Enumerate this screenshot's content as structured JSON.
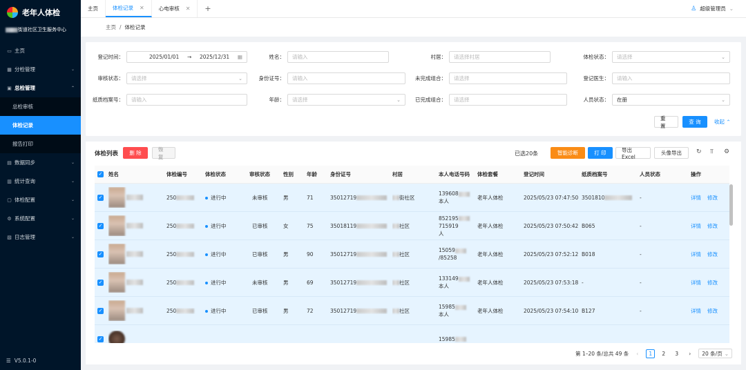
{
  "app": {
    "title": "老年人体检",
    "org_suffix": "街道社区卫生服务中心",
    "version": "V5.0.1-0"
  },
  "sidebar": {
    "items": [
      {
        "label": "主页",
        "icon": "home-icon"
      },
      {
        "label": "分检管理",
        "icon": "grid-icon"
      },
      {
        "label": "总检管理",
        "icon": "file-icon"
      },
      {
        "label": "数据同步",
        "icon": "sync-icon"
      },
      {
        "label": "统计查询",
        "icon": "chart-icon"
      },
      {
        "label": "体检配置",
        "icon": "settings-icon"
      },
      {
        "label": "系统配置",
        "icon": "gear-icon"
      },
      {
        "label": "日志管理",
        "icon": "log-icon"
      }
    ],
    "sub_items": [
      "总检审核",
      "体检记录",
      "报告打印"
    ]
  },
  "tabs": [
    {
      "label": "主页"
    },
    {
      "label": "体检记录"
    },
    {
      "label": "心电审核"
    }
  ],
  "user": {
    "name": "超级管理员"
  },
  "breadcrumb": {
    "home": "主页",
    "current": "体检记录"
  },
  "filter": {
    "date_label": "登记时间：",
    "date_start": "2025/01/01",
    "date_sep": "→",
    "date_end": "2025/12/31",
    "name_label": "姓名：",
    "name_ph": "请输入",
    "village_label": "村居：",
    "village_ph": "请选择村居",
    "exam_status_label": "体检状态：",
    "exam_status_ph": "请选择",
    "audit_status_label": "审核状态：",
    "audit_status_ph": "请选择",
    "id_label": "身份证号：",
    "id_ph": "请输入",
    "unfinished_label": "未完成组合：",
    "unfinished_ph": "请选择",
    "doctor_label": "登记医生：",
    "doctor_ph": "请输入",
    "paper_label": "纸质档案号：",
    "paper_ph": "请输入",
    "age_label": "年龄：",
    "age_ph": "请选择",
    "finished_label": "已完成组合：",
    "finished_ph": "请选择",
    "person_status_label": "人员状态：",
    "person_status_value": "在册",
    "reset": "重 置",
    "search": "查 询",
    "collapse": "收起"
  },
  "list": {
    "title": "体检列表",
    "delete": "删 除",
    "restore": "恢 复",
    "selected": "已选20条",
    "smart": "智能诊断",
    "print": "打 印",
    "export_excel": "导出Excel",
    "export_avatar": "头像导出",
    "columns": [
      "姓名",
      "体检编号",
      "体检状态",
      "审核状态",
      "性别",
      "年龄",
      "身份证号",
      "村居",
      "本人电话号码",
      "体检套餐",
      "登记时间",
      "纸质档案号",
      "人员状态",
      "操作"
    ],
    "rows": [
      {
        "no": "250",
        "status": "进行中",
        "audit": "未审核",
        "sex": "男",
        "age": "71",
        "id": "35012719",
        "village": "街社区",
        "phone1": "139608",
        "phone2": "本人",
        "pkg": "老年人体检",
        "time": "2025/05/23 07:47:50",
        "paper": "3501810",
        "pstatus": "-"
      },
      {
        "no": "250",
        "status": "进行中",
        "audit": "已审核",
        "sex": "女",
        "age": "75",
        "id": "35018119",
        "village": "社区",
        "phone1": "852195",
        "phone2": "715919",
        "phone3": "人",
        "pkg": "老年人体检",
        "time": "2025/05/23 07:50:42",
        "paper": "B065",
        "pstatus": "-"
      },
      {
        "no": "250",
        "status": "进行中",
        "audit": "已审核",
        "sex": "男",
        "age": "90",
        "id": "35012719",
        "village": "社区",
        "phone1": "15059",
        "phone2": "/85258",
        "pkg": "老年人体检",
        "time": "2025/05/23 07:52:12",
        "paper": "B018",
        "pstatus": "-"
      },
      {
        "no": "250",
        "status": "进行中",
        "audit": "未审核",
        "sex": "男",
        "age": "69",
        "id": "35012719",
        "village": "社区",
        "phone1": "133149",
        "phone2": "本人",
        "pkg": "老年人体检",
        "time": "2025/05/23 07:53:18",
        "paper": "-",
        "pstatus": "-"
      },
      {
        "no": "250",
        "status": "进行中",
        "audit": "已审核",
        "sex": "男",
        "age": "72",
        "id": "35012719",
        "village": "社区",
        "phone1": "15985",
        "phone2": "本人",
        "pkg": "老年人体检",
        "time": "2025/05/23 07:54:10",
        "paper": "B127",
        "pstatus": "-"
      },
      {
        "no": "",
        "status": "",
        "audit": "",
        "sex": "",
        "age": "",
        "id": "",
        "village": "",
        "phone1": "15985",
        "phone2": "",
        "pkg": "",
        "time": "",
        "paper": "",
        "pstatus": ""
      }
    ],
    "op_detail": "详情",
    "op_edit": "修改"
  },
  "pager": {
    "summary": "第 1–20 条/总共 49 条",
    "pages": [
      "1",
      "2",
      "3"
    ],
    "size": "20 条/页"
  }
}
